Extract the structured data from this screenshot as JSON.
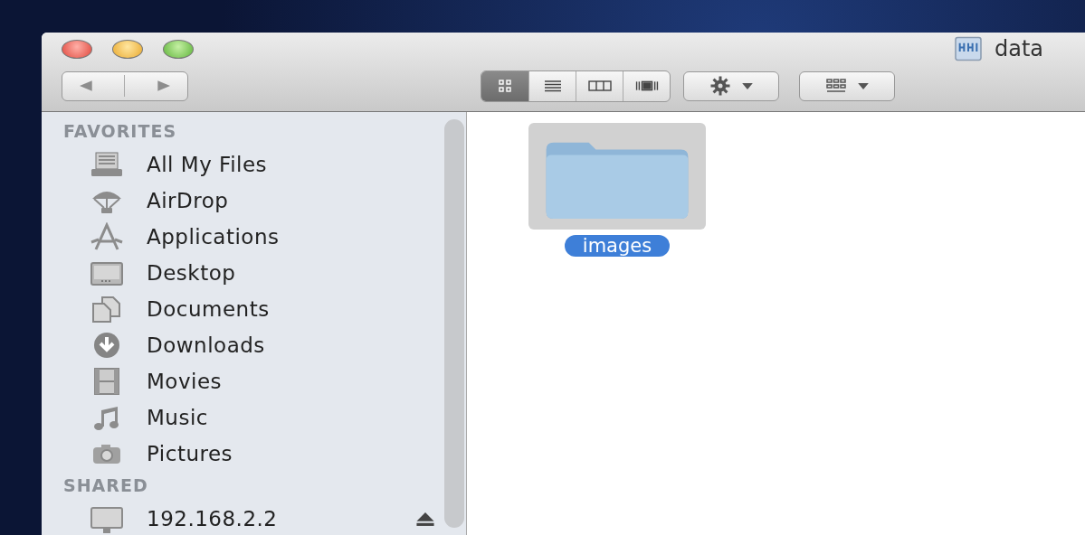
{
  "window": {
    "title": "data"
  },
  "toolbar": {
    "view_modes": [
      {
        "kind": "icon",
        "selected": true
      },
      {
        "kind": "list",
        "selected": false
      },
      {
        "kind": "columns",
        "selected": false
      },
      {
        "kind": "coverflow",
        "selected": false
      }
    ]
  },
  "sidebar": {
    "sections": [
      {
        "heading": "FAVORITES",
        "items": [
          {
            "label": "All My Files",
            "kind": "files",
            "ejectable": false
          },
          {
            "label": "AirDrop",
            "kind": "airdrop",
            "ejectable": false
          },
          {
            "label": "Applications",
            "kind": "apps",
            "ejectable": false
          },
          {
            "label": "Desktop",
            "kind": "desktop",
            "ejectable": false
          },
          {
            "label": "Documents",
            "kind": "documents",
            "ejectable": false
          },
          {
            "label": "Downloads",
            "kind": "downloads",
            "ejectable": false
          },
          {
            "label": "Movies",
            "kind": "movies",
            "ejectable": false
          },
          {
            "label": "Music",
            "kind": "music",
            "ejectable": false
          },
          {
            "label": "Pictures",
            "kind": "pictures",
            "ejectable": false
          }
        ]
      },
      {
        "heading": "SHARED",
        "items": [
          {
            "label": "192.168.2.2",
            "kind": "computer",
            "ejectable": true
          }
        ]
      }
    ]
  },
  "files": [
    {
      "name": "images",
      "selected": true
    }
  ]
}
